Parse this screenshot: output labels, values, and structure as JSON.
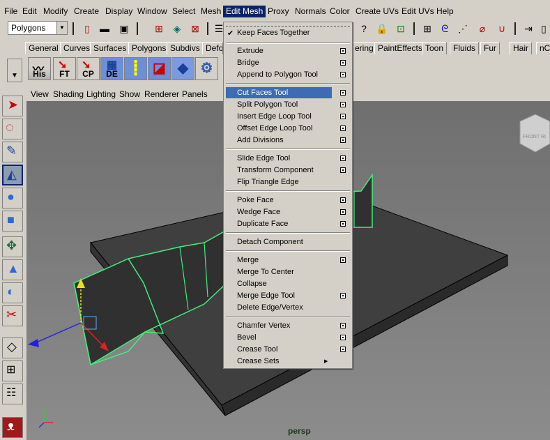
{
  "menubar": [
    "File",
    "Edit",
    "Modify",
    "Create",
    "Display",
    "Window",
    "Select",
    "Mesh",
    "Edit Mesh",
    "Proxy",
    "Normals",
    "Color",
    "Create UVs",
    "Edit UVs",
    "Help"
  ],
  "status": {
    "mode": "Polygons"
  },
  "shelf_tabs": [
    "General",
    "Curves",
    "Surfaces",
    "Polygons",
    "Subdivs",
    "Defor",
    "ering",
    "PaintEffects",
    "Toon",
    "Fluids",
    "Fur",
    "Hair",
    "nC"
  ],
  "shelf_icons": [
    "His",
    "FT",
    "CP",
    "DE"
  ],
  "panel_menu": [
    "View",
    "Shading",
    "Lighting",
    "Show",
    "Renderer",
    "Panels"
  ],
  "viewport_label": "persp",
  "view_cube": {
    "front": "FRONT",
    "right": "RI"
  },
  "edit_mesh_menu": {
    "keep_faces": "Keep Faces Together",
    "groups": [
      [
        "Extrude",
        "Bridge",
        "Append to Polygon Tool"
      ],
      [
        "Cut Faces Tool",
        "Split Polygon Tool",
        "Insert Edge Loop Tool",
        "Offset Edge Loop Tool",
        "Add Divisions"
      ],
      [
        "Slide Edge Tool",
        "Transform Component",
        "Flip Triangle Edge"
      ],
      [
        "Poke Face",
        "Wedge Face",
        "Duplicate Face"
      ],
      [
        "Detach Component"
      ],
      [
        "Merge",
        "Merge To Center",
        "Collapse",
        "Merge Edge Tool",
        "Delete Edge/Vertex"
      ],
      [
        "Chamfer Vertex",
        "Bevel",
        "Crease Tool",
        "Crease Sets"
      ]
    ]
  },
  "colors": {
    "menu_highlight": "#3d6bb4",
    "selection_edge": "#3cf07a",
    "viewport_bg": "#7a7a7a",
    "mesh_face": "#3f3f3f"
  }
}
